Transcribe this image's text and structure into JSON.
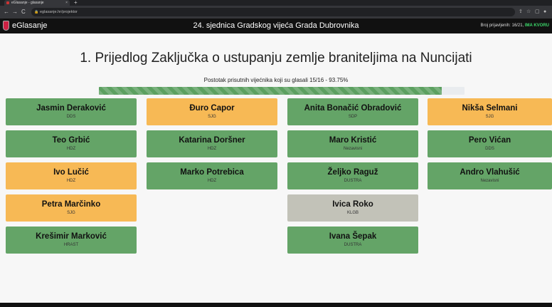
{
  "browser": {
    "tab_title": "eGlasanje - glasanje",
    "tab_close": "×",
    "new_tab": "+",
    "back": "←",
    "forward": "→",
    "reload": "C",
    "url": "eglasanje.hr/projektor",
    "lock": "🔒",
    "icons": [
      "share-icon",
      "star-icon",
      "extensions-icon",
      "profile-icon"
    ],
    "icon_glyphs": [
      "⇪",
      "☆",
      "▢",
      "●"
    ]
  },
  "app": {
    "brand": "eGlasanje",
    "session_title": "24. sjednica Gradskog vijeća Grada Dubrovnika",
    "registered_label": "Broj prijavljenih: 16/21, ",
    "quorum_label": "IMA KVORU",
    "quorum_color": "#3cd66a"
  },
  "agenda": {
    "title": "1. Prijedlog Zaključka o ustupanju zemlje braniteljima na Nuncijati",
    "percent_text": "Postotak prisutnih vijećnika koji su glasali 15/16 - 93.75%",
    "percent_value": 93.75
  },
  "colors": {
    "green": "#64a467",
    "orange": "#f7b955",
    "grey": "#c2c2b8"
  },
  "councillors": [
    {
      "name": "Jasmin Deraković",
      "party": "DDS",
      "color": "green"
    },
    {
      "name": "Teo Grbić",
      "party": "HDZ",
      "color": "green"
    },
    {
      "name": "Ivo Lučić",
      "party": "HDZ",
      "color": "orange"
    },
    {
      "name": "Petra Marčinko",
      "party": "SJG",
      "color": "orange"
    },
    {
      "name": "Krešimir Marković",
      "party": "HRAST",
      "color": "green"
    },
    {
      "name": "Đuro Capor",
      "party": "SJG",
      "color": "orange"
    },
    {
      "name": "Katarina Doršner",
      "party": "HDZ",
      "color": "green"
    },
    {
      "name": "Marko Potrebica",
      "party": "HDZ",
      "color": "green"
    },
    {
      "name": "Anita Bonačić Obradović",
      "party": "SDP",
      "color": "green"
    },
    {
      "name": "Maro Kristić",
      "party": "Nezavisni",
      "color": "green"
    },
    {
      "name": "Željko Raguž",
      "party": "DUSTRA",
      "color": "green"
    },
    {
      "name": "Ivica Roko",
      "party": "KLGB",
      "color": "grey"
    },
    {
      "name": "Ivana Šepak",
      "party": "DUSTRA",
      "color": "green"
    },
    {
      "name": "Nikša Selmani",
      "party": "SJG",
      "color": "orange"
    },
    {
      "name": "Pero Vićan",
      "party": "DDS",
      "color": "green"
    },
    {
      "name": "Andro Vlahušić",
      "party": "Nezavisni",
      "color": "green"
    }
  ]
}
